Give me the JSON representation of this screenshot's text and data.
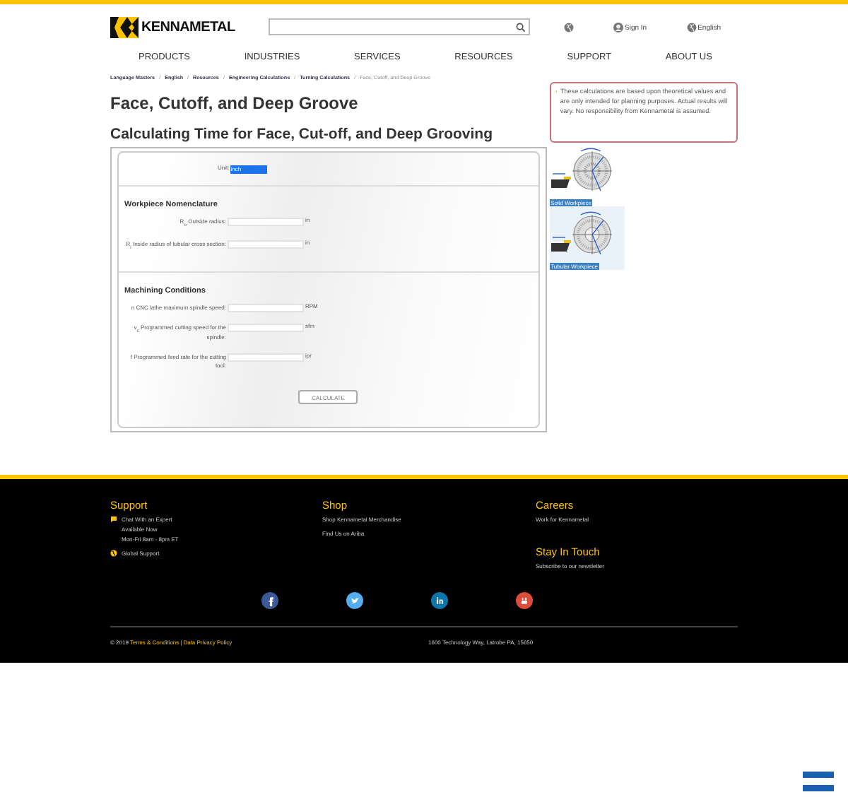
{
  "header": {
    "logo": "KENNAMETAL",
    "links": [
      {
        "kind": "globe"
      },
      {
        "kind": "user",
        "label": "Sign In"
      },
      {
        "kind": "globe",
        "label": "English"
      }
    ]
  },
  "nav": [
    "PRODUCTS",
    "INDUSTRIES",
    "SERVICES",
    "RESOURCES",
    "SUPPORT",
    "ABOUT US"
  ],
  "breadcrumb_separator": "/",
  "breadcrumb": [
    {
      "label": "Language Masters",
      "current": false
    },
    {
      "label": "English",
      "current": false
    },
    {
      "label": "Resources",
      "current": false
    },
    {
      "label": "Engineering Calculations",
      "current": false
    },
    {
      "label": "Turning Calculations",
      "current": false
    },
    {
      "label": "Face, Cutoff, and Deep Groove",
      "current": true
    }
  ],
  "title": "Face, Cutoff, and Deep Groove",
  "subtitle": "Calculating Time for Face, Cut-off, and Deep Grooving",
  "notice": "These calculations are based upon theoretical values and are only intended for planning purposes. Actual results will vary. No responsibility from Kennametal is assumed.",
  "calculator": {
    "unit": {
      "label": "Unit:",
      "value": "inch"
    },
    "sections": [
      {
        "title": "Workpiece Nomenclature",
        "fields": [
          {
            "label": "R$_{o}$ Outside radius:",
            "unit": "in"
          },
          {
            "label": "R$_{i}$ Inside radius of tubular cross section:",
            "unit": "in"
          }
        ]
      },
      {
        "title": "Machining Conditions",
        "fields": [
          {
            "label": "n CNC lathe maximum spindle speed:",
            "unit": "RPM"
          },
          {
            "label": "v$_{c}$ Programmed cutting speed for the spindle:",
            "unit": "sfm"
          },
          {
            "label": "f Programmed feed rate for the cutting tool:",
            "unit": "ipr"
          }
        ]
      }
    ],
    "button": "CALCULATE"
  },
  "figures": [
    {
      "caption": "Solid Workpiece",
      "tubular": false
    },
    {
      "caption": "Tubular Workpiece",
      "tubular": true
    }
  ],
  "footer": {
    "columns": [
      {
        "sections": [
          {
            "title": "Support",
            "items": [
              {
                "kind": "chat",
                "lines": [
                  "Chat With an Expert",
                  "Available Now",
                  "Mon-Fri 8am - 8pm ET"
                ]
              },
              {
                "kind": "globe",
                "lines": [
                  "Global Support"
                ]
              }
            ]
          }
        ]
      },
      {
        "sections": [
          {
            "title": "Shop",
            "items": [
              {
                "kind": "text",
                "lines": [
                  "Shop Kennametal Merchandise"
                ]
              },
              {
                "kind": "text",
                "lines": [
                  "Find Us on Ariba"
                ]
              }
            ]
          }
        ]
      },
      {
        "sections": [
          {
            "title": "Careers",
            "items": [
              {
                "kind": "text",
                "lines": [
                  "Work for Kennametal"
                ]
              }
            ]
          },
          {
            "title": "Stay In Touch",
            "items": [
              {
                "kind": "text",
                "lines": [
                  "Subscribe to our newsletter"
                ]
              }
            ]
          }
        ]
      }
    ],
    "social": [
      {
        "kind": "facebook",
        "color": "#3b5998"
      },
      {
        "kind": "twitter",
        "color": "#55acee"
      },
      {
        "kind": "linkedin",
        "color": "#0e76a8"
      },
      {
        "kind": "youtube",
        "color": "#dd4b39"
      }
    ],
    "copyright": "© 2019",
    "legal_links": [
      "Terms & Conditions",
      "Data Privacy Policy"
    ],
    "separator": "|",
    "address": "1600 Technology Way, Latrobe PA, 15650"
  }
}
